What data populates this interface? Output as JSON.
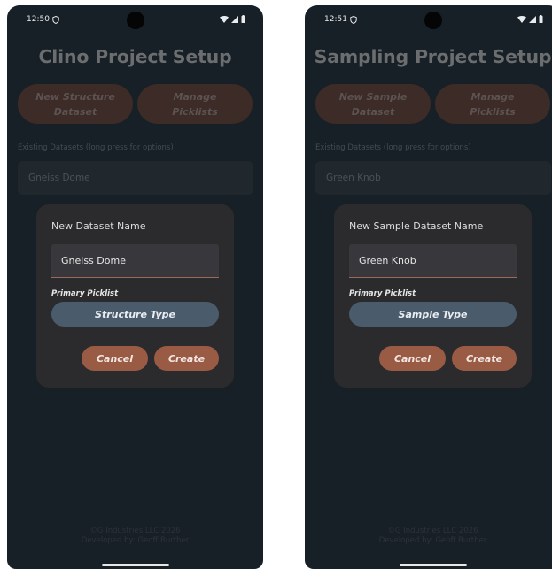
{
  "colors": {
    "screen_bg": "#172026",
    "dialog_bg": "#2b2b2e",
    "accent_button": "#9a5b44",
    "picklist_button": "#4a5c6b",
    "dimmed_button": "#3c2b26"
  },
  "screens": [
    {
      "status": {
        "time": "12:50",
        "icons": [
          "vpn-shield-icon",
          "wifi-icon",
          "signal-icon",
          "battery-icon"
        ]
      },
      "title": "Clino Project Setup",
      "buttons": {
        "new_dataset": [
          "New Structure",
          "Dataset"
        ],
        "manage_picklists": [
          "Manage",
          "Picklists"
        ]
      },
      "existing_label": "Existing Datasets (long press for options)",
      "existing_dataset": "Gneiss Dome",
      "dialog": {
        "title": "New Dataset Name",
        "name_value": "Gneiss Dome",
        "picklist_label": "Primary Picklist",
        "picklist_button": "Structure Type",
        "cancel": "Cancel",
        "create": "Create"
      },
      "footer": [
        "©G Industries LLC 2026",
        "Developed by: Geoff Burther"
      ]
    },
    {
      "status": {
        "time": "12:51",
        "icons": [
          "vpn-shield-icon",
          "wifi-icon",
          "signal-icon",
          "battery-icon"
        ]
      },
      "title": "Sampling Project Setup",
      "buttons": {
        "new_dataset": [
          "New Sample",
          "Dataset"
        ],
        "manage_picklists": [
          "Manage",
          "Picklists"
        ]
      },
      "existing_label": "Existing Datasets (long press for options)",
      "existing_dataset": "Green Knob",
      "dialog": {
        "title": "New Sample Dataset Name",
        "name_value": "Green Knob",
        "picklist_label": "Primary Picklist",
        "picklist_button": "Sample Type",
        "cancel": "Cancel",
        "create": "Create"
      },
      "footer": [
        "©G Industries LLC 2026",
        "Developed by: Geoff Burther"
      ]
    }
  ]
}
